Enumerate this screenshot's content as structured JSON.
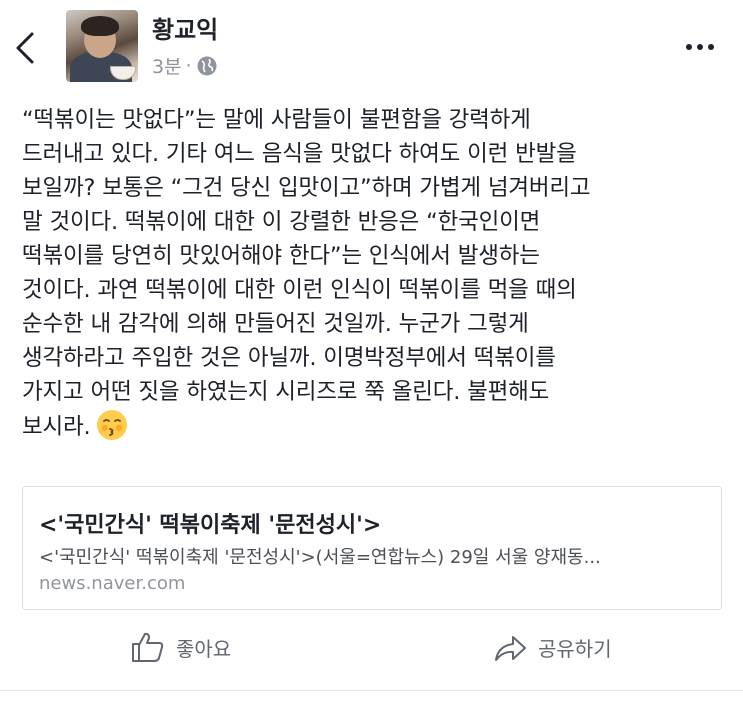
{
  "header": {
    "back_icon": "chevron-left-icon",
    "author_name": "황교익",
    "timestamp": "3분",
    "separator": "·",
    "privacy_icon": "globe-icon",
    "more_icon": "more-horizontal-icon"
  },
  "post": {
    "lines": [
      "“떡볶이는 맛없다”는 말에 사람들이 불편함을 강력하게",
      "드러내고 있다. 기타 여느 음식을 맛없다 하여도 이런 반발을",
      "보일까? 보통은 “그건 당신 입맛이고”하며 가볍게 넘겨버리고",
      "말 것이다. 떡볶이에 대한 이 강렬한 반응은 “한국인이면",
      "떡볶이를 당연히 맛있어해야 한다”는 인식에서 발생하는",
      "것이다. 과연 떡볶이에 대한 이런 인식이 떡볶이를 먹을 때의",
      "순수한 내 감각에 의해 만들어진 것일까. 누군가 그렇게",
      "생각하라고 주입한 것은 아닐까. 이명박정부에서 떡볶이를",
      "가지고 어떤 짓을 하였는지 시리즈로 쭉 올린다. 불편해도",
      "보시라."
    ],
    "emoji_icon": "kissing-face-emoji-icon"
  },
  "link_card": {
    "title": "<'국민간식' 떡볶이축제 '문전성시'>",
    "description": "<'국민간식' 떡볶이축제 '문전성시'>(서울=연합뉴스) 29일 서울 양재동...",
    "domain": "news.naver.com"
  },
  "actions": {
    "like_label": "좋아요",
    "like_icon": "thumbs-up-icon",
    "share_label": "공유하기",
    "share_icon": "share-arrow-icon"
  }
}
